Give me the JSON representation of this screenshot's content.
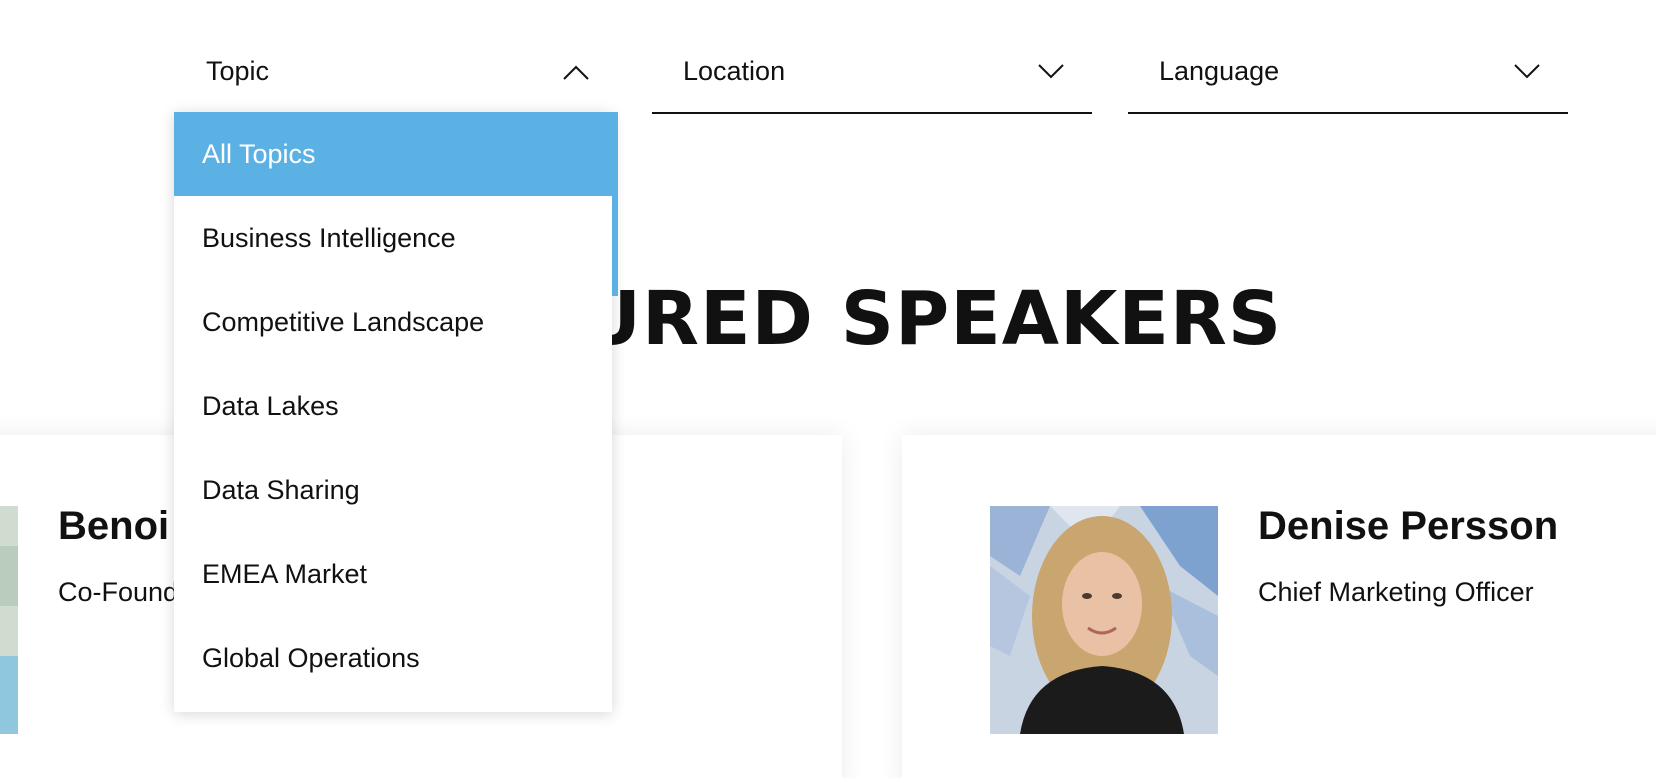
{
  "filters": {
    "topic": {
      "label": "Topic",
      "icon": "chevron-up-icon",
      "expanded": true
    },
    "location": {
      "label": "Location",
      "icon": "chevron-down-icon"
    },
    "language": {
      "label": "Language",
      "icon": "chevron-down-icon"
    }
  },
  "topic_dropdown": {
    "selected": "All Topics",
    "options": [
      "All Topics",
      "Business Intelligence",
      "Competitive Landscape",
      "Data Lakes",
      "Data Sharing",
      "EMEA Market",
      "Global Operations"
    ]
  },
  "section": {
    "title": "FEATURED SPEAKERS"
  },
  "speakers": [
    {
      "name": "Benoi",
      "role": "Co-Found"
    },
    {
      "name": "Denise Persson",
      "role": "Chief Marketing Officer"
    }
  ],
  "colors": {
    "accent": "#5bb1e4",
    "text": "#111111",
    "background": "#ffffff"
  }
}
